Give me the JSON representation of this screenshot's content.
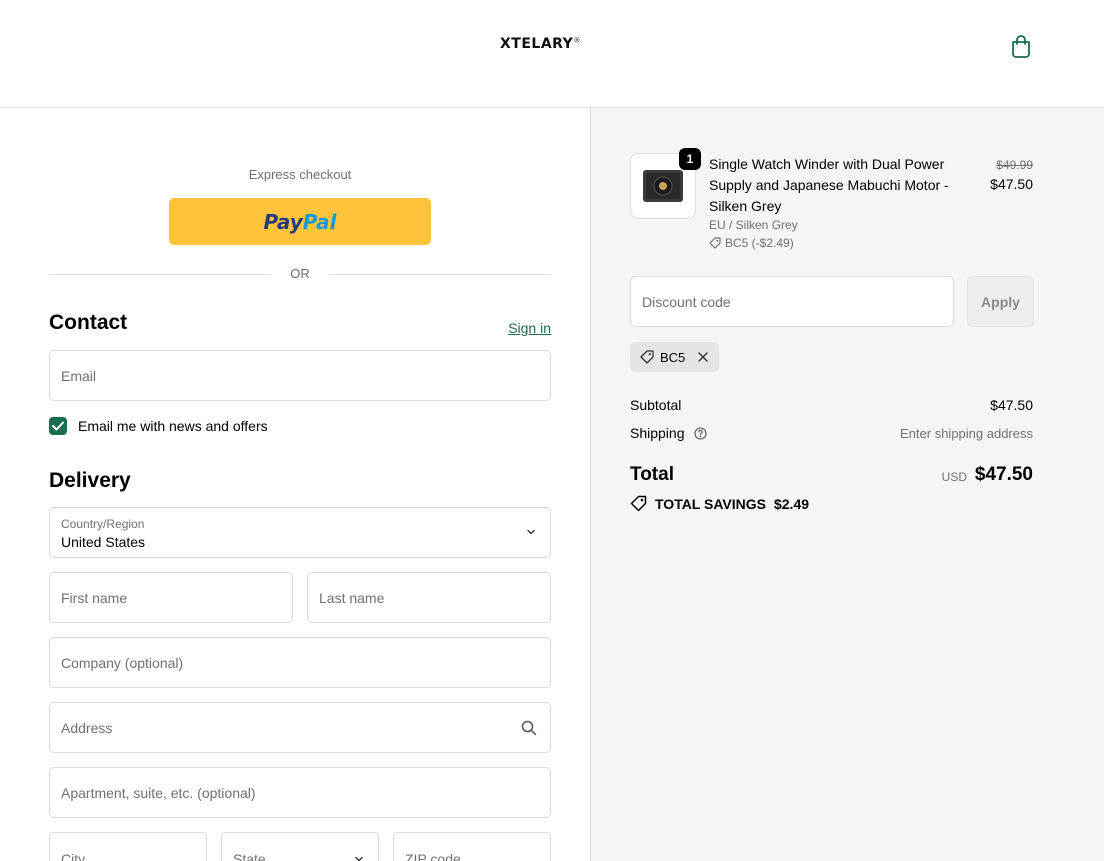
{
  "header": {
    "logo_text": "XTELARY",
    "logo_mark": "®"
  },
  "express": {
    "label": "Express checkout",
    "paypal_pay": "Pay",
    "paypal_pal": "Pal",
    "or_label": "OR"
  },
  "contact": {
    "title": "Contact",
    "sign_in": "Sign in",
    "email_placeholder": "Email",
    "newsletter_label": "Email me with news and offers",
    "newsletter_checked": true
  },
  "delivery": {
    "title": "Delivery",
    "country_label": "Country/Region",
    "country_value": "United States",
    "first_name_placeholder": "First name",
    "last_name_placeholder": "Last name",
    "company_placeholder": "Company (optional)",
    "address_placeholder": "Address",
    "apartment_placeholder": "Apartment, suite, etc. (optional)",
    "city_placeholder": "City",
    "state_label": "State",
    "zip_placeholder": "ZIP code"
  },
  "order": {
    "item": {
      "quantity": "1",
      "name": "Single Watch Winder with Dual Power Supply and Japanese Mabuchi Motor - Silken Grey",
      "variant": "EU / Silken Grey",
      "discount": "BC5 (-$2.49)",
      "price_original": "$49.99",
      "price": "$47.50"
    },
    "discount_placeholder": "Discount code",
    "apply_label": "Apply",
    "applied_code": "BC5",
    "subtotal_label": "Subtotal",
    "subtotal_value": "$47.50",
    "shipping_label": "Shipping",
    "shipping_value": "Enter shipping address",
    "total_label": "Total",
    "currency": "USD",
    "total_value": "$47.50",
    "savings_label": "TOTAL SAVINGS",
    "savings_value": "$2.49"
  },
  "colors": {
    "accent": "#1a6e4b",
    "paypal_yellow": "#ffc439",
    "summary_bg": "#f5f5f5"
  }
}
